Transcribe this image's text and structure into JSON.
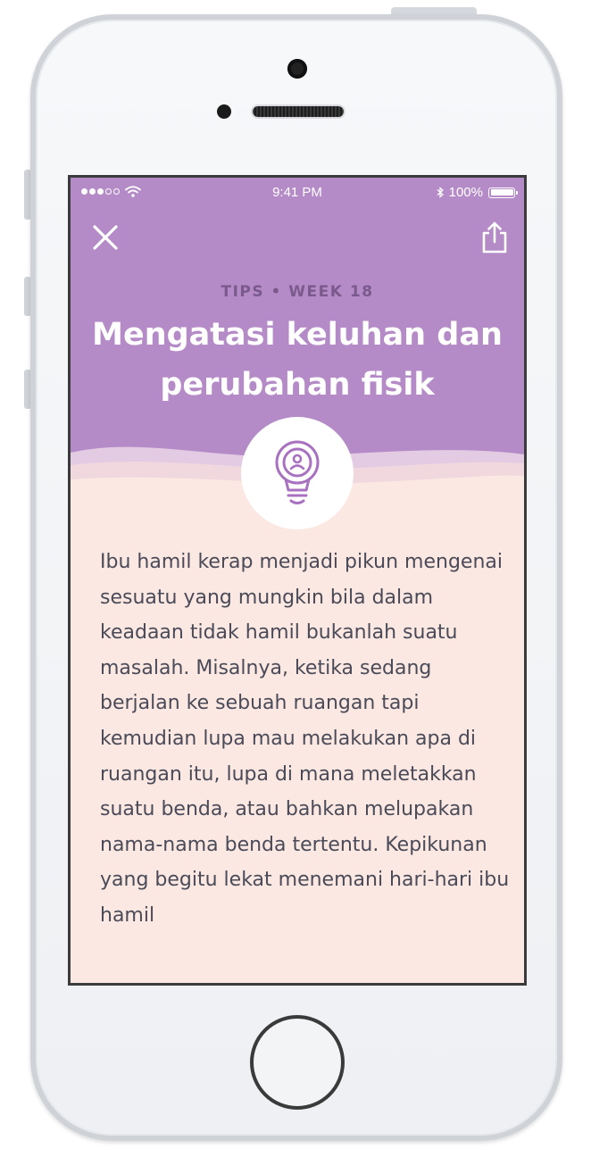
{
  "status_bar": {
    "time": "9:41 PM",
    "battery": "100%",
    "battery_level": 1.0
  },
  "header": {
    "close_icon": "close-icon",
    "share_icon": "share-icon",
    "eyebrow": "TIPS • WEEK 18",
    "title": "Mengatasi keluhan dan perubahan fisik",
    "feature_icon": "lightbulb-person-icon"
  },
  "article": {
    "body": "Ibu hamil kerap menjadi pikun mengenai sesuatu yang mungkin bila dalam keadaan tidak hamil bukanlah suatu masalah. Misalnya, ketika sedang berjalan ke sebuah ruangan tapi kemudian lupa mau melakukan apa di ruangan itu, lupa di mana meletakkan suatu benda, atau bahkan melupakan nama-nama benda tertentu. Kepikunan yang begitu lekat menemani hari-hari ibu hamil"
  },
  "colors": {
    "header_bg": "#b48bc6",
    "content_bg": "#fbe8e2",
    "eyebrow": "#7a5a8c",
    "icon_stroke": "#a872c0",
    "body_text": "#4a4a58"
  }
}
